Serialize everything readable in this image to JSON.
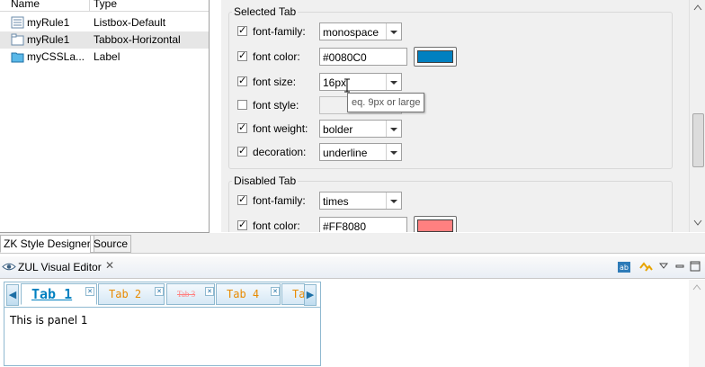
{
  "tree": {
    "columns": [
      "Name",
      "Type"
    ],
    "rows": [
      {
        "name": "myRule1",
        "type": "Listbox-Default",
        "icon": "listbox-icon",
        "selected": false
      },
      {
        "name": "myRule1",
        "type": "Tabbox-Horizontal",
        "icon": "tabbox-icon",
        "selected": true
      },
      {
        "name": "myCSSLa...",
        "type": "Label",
        "icon": "folder-icon",
        "selected": false
      }
    ]
  },
  "selected_tab": {
    "title": "Selected Tab",
    "font_family": {
      "label": "font-family:",
      "value": "monospace"
    },
    "font_color": {
      "label": "font color:",
      "value": "#0080C0",
      "swatch": "#0080C0"
    },
    "font_size": {
      "label": "font size:",
      "value": "16px"
    },
    "font_style": {
      "label": "font style:"
    },
    "font_weight": {
      "label": "font weight:",
      "value": "bolder"
    },
    "decoration": {
      "label": "decoration:",
      "value": "underline"
    },
    "tooltip": "eq. 9px or large"
  },
  "disabled_tab": {
    "title": "Disabled Tab",
    "font_family": {
      "label": "font-family:",
      "value": "times"
    },
    "font_color": {
      "label": "font color:",
      "value": "#FF8080",
      "swatch": "#FF8080"
    }
  },
  "editor_tabs": [
    "ZK Style Designer",
    "Source"
  ],
  "view": {
    "title": "ZUL Visual Editor"
  },
  "zk_tabbox": {
    "tabs": [
      "Tab 1",
      "Tab 2",
      "Tab 3",
      "Tab 4",
      "Ta"
    ],
    "panel": "This is panel 1"
  }
}
